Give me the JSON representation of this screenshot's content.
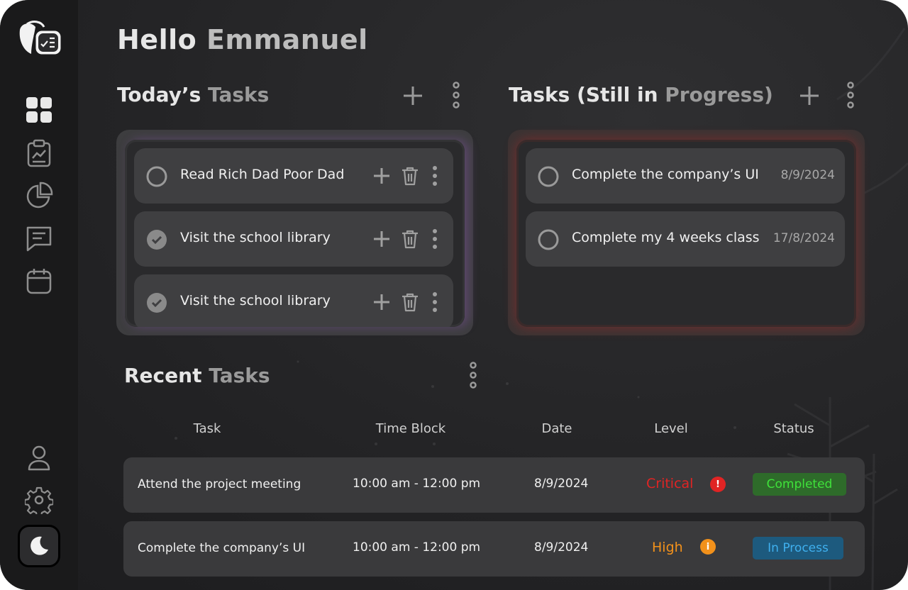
{
  "greeting": {
    "hello": "Hello",
    "name": "Emmanuel"
  },
  "sidebar": {
    "nav": [
      {
        "id": "dashboard",
        "icon": "dashboard-grid-icon"
      },
      {
        "id": "tasks-report",
        "icon": "clipboard-chart-icon"
      },
      {
        "id": "analytics",
        "icon": "pie-chart-icon"
      },
      {
        "id": "messages",
        "icon": "message-icon"
      },
      {
        "id": "calendar",
        "icon": "calendar-icon"
      }
    ],
    "bottom": [
      {
        "id": "profile",
        "icon": "user-icon"
      },
      {
        "id": "settings",
        "icon": "gear-icon"
      },
      {
        "id": "theme",
        "icon": "moon-icon"
      }
    ]
  },
  "today": {
    "title_a": "Today’s",
    "title_b": "Tasks",
    "tasks": [
      {
        "label": "Read Rich Dad Poor Dad",
        "done": false
      },
      {
        "label": "Visit the school library",
        "done": true
      },
      {
        "label": "Visit the school library",
        "done": true
      }
    ]
  },
  "progress": {
    "title_a": "Tasks (Still in",
    "title_b": "Progress)",
    "tasks": [
      {
        "label": "Complete the company’s UI",
        "date": "8/9/2024"
      },
      {
        "label": "Complete my 4 weeks class",
        "date": "17/8/2024"
      }
    ]
  },
  "recent": {
    "title_a": "Recent",
    "title_b": "Tasks",
    "headers": [
      "Task",
      "Time Block",
      "Date",
      "Level",
      "Status"
    ],
    "rows": [
      {
        "task": "Attend the project meeting",
        "time": "10:00 am - 12:00 pm",
        "date": "8/9/2024",
        "level": "Critical",
        "level_color": "#e02424",
        "status": "Completed"
      },
      {
        "task": "Complete the company’s UI",
        "time": "10:00 am - 12:00 pm",
        "date": "8/9/2024",
        "level": "High",
        "level_color": "#f2911b",
        "status": "In Process"
      }
    ]
  },
  "colors": {
    "critical": "#e02424",
    "high": "#f2911b",
    "completed": "#3fe23a",
    "in_process": "#3fb0ef"
  }
}
